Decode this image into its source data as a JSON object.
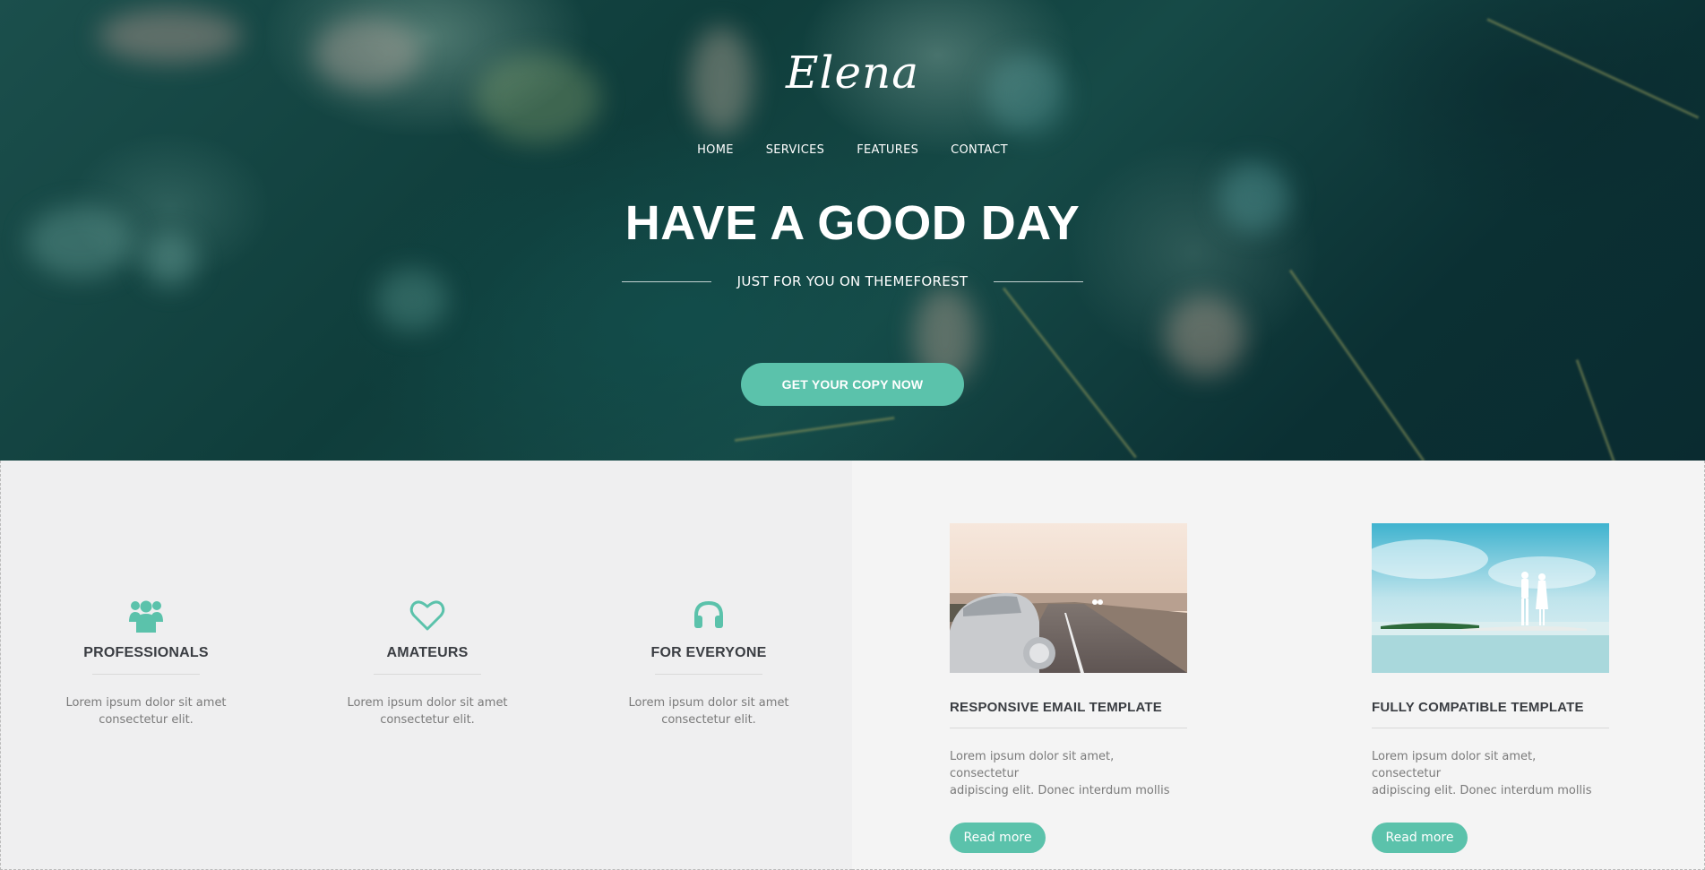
{
  "brand": {
    "logo": "Elena",
    "accent_color": "#5bc2ab"
  },
  "nav": {
    "items": [
      {
        "label": "HOME"
      },
      {
        "label": "SERVICES"
      },
      {
        "label": "FEATURES"
      },
      {
        "label": "CONTACT"
      }
    ]
  },
  "hero": {
    "headline": "HAVE A GOOD DAY",
    "subtitle": "JUST FOR YOU ON THEMEFOREST",
    "cta_label": "GET YOUR COPY NOW"
  },
  "features": [
    {
      "icon": "users-icon",
      "title": "PROFESSIONALS",
      "text_line1": "Lorem ipsum dolor sit amet",
      "text_line2": "consectetur elit."
    },
    {
      "icon": "heart-icon",
      "title": "AMATEURS",
      "text_line1": "Lorem ipsum dolor sit amet",
      "text_line2": "consectetur elit."
    },
    {
      "icon": "headphones-icon",
      "title": "FOR EVERYONE",
      "text_line1": "Lorem ipsum dolor sit amet",
      "text_line2": "consectetur elit."
    }
  ],
  "posts": [
    {
      "image": "vintage-convertible-car-photo",
      "title": "RESPONSIVE EMAIL TEMPLATE",
      "text_line1": "Lorem ipsum dolor sit amet, consectetur",
      "text_line2": "adipiscing elit. Donec interdum mollis",
      "button": "Read more"
    },
    {
      "image": "couple-on-beach-photo",
      "title": "FULLY COMPATIBLE TEMPLATE",
      "text_line1": "Lorem ipsum dolor sit amet, consectetur",
      "text_line2": "adipiscing elit. Donec interdum mollis",
      "button": "Read more"
    }
  ]
}
